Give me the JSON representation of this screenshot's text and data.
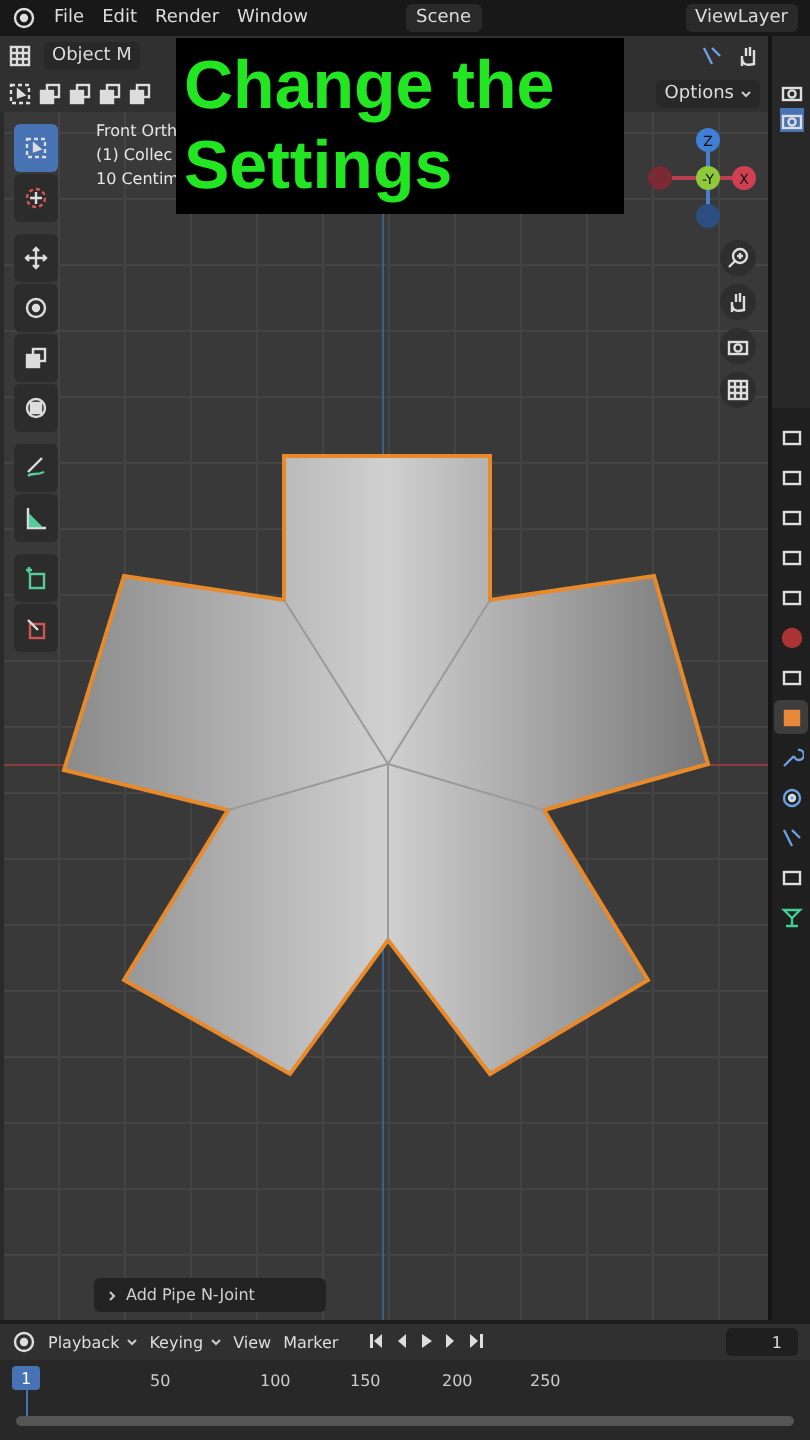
{
  "menu_bar": {
    "items": [
      "File",
      "Edit",
      "Render",
      "Window"
    ],
    "scene": "Scene",
    "view_layer": "ViewLayer"
  },
  "header": {
    "mode": "Object M",
    "options": "Options"
  },
  "caption": {
    "lines": [
      "Change the",
      "Settings"
    ]
  },
  "viewport_info": [
    "Front Orth",
    "(1) Collec",
    "10 Centim"
  ],
  "gizmo": {
    "z": "Z",
    "y": "-Y",
    "x": "X"
  },
  "tools": [
    {
      "selected": true
    },
    {
      "selected": false
    },
    {
      "selected": false
    },
    {
      "selected": false
    },
    {
      "selected": false
    },
    {
      "selected": false
    },
    {
      "selected": false
    },
    {
      "selected": false
    },
    {
      "selected": false
    },
    {
      "selected": false
    }
  ],
  "operator_panel": {
    "label": "Add Pipe N-Joint",
    "expanded": false
  },
  "property_tabs": [
    {
      "selected": false
    },
    {
      "selected": false
    },
    {
      "selected": false
    },
    {
      "selected": false
    },
    {
      "selected": false
    },
    {
      "selected": false
    },
    {
      "selected": false
    },
    {
      "selected": true
    },
    {
      "selected": false
    },
    {
      "selected": false
    },
    {
      "selected": false
    },
    {
      "selected": false
    },
    {
      "selected": false
    }
  ],
  "timeline": {
    "menus": [
      "Playback",
      "Keying",
      "View",
      "Marker"
    ],
    "current_frame": "1",
    "ruler": [
      "50",
      "100",
      "150",
      "200",
      "250"
    ],
    "playhead": "1"
  }
}
